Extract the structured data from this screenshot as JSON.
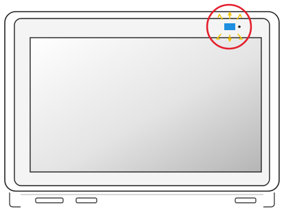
{
  "device": {
    "bezel_color": "#f4f4f4",
    "outline_color": "#222222",
    "camera_led_color": "#1f8fe0",
    "indicator_dot_color": "#222222",
    "highlight_ring_color": "#e41e2b",
    "glow_ray_color": "#f2c200",
    "screen_gradient": [
      "#ffffff",
      "#e4e4e4",
      "#b5b5b5"
    ]
  }
}
